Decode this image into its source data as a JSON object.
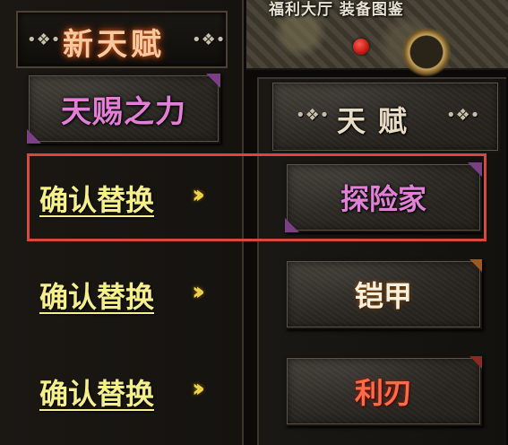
{
  "banner": {
    "text": "福利大厅 装备图鉴"
  },
  "left_panel": {
    "title": "新天赋",
    "deco_left": "•❖•",
    "deco_right": "•❖•",
    "current_talent": "天赐之力",
    "confirm_rows": [
      {
        "label": "确认替换",
        "arrows": "››"
      },
      {
        "label": "确认替换",
        "arrows": "››"
      },
      {
        "label": "确认替换",
        "arrows": "››"
      }
    ]
  },
  "right_panel": {
    "title": "天赋",
    "deco_left": "•❖•",
    "deco_right": "•❖•",
    "talents": [
      {
        "label": "探险家",
        "color": "#e080d6"
      },
      {
        "label": "铠甲",
        "color": "#f8f0e0"
      },
      {
        "label": "利刃",
        "color": "#ff6a48"
      }
    ]
  },
  "highlight_color": "#d9483a"
}
